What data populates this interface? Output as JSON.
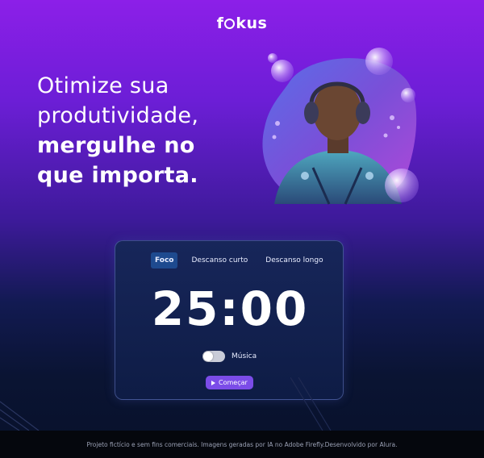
{
  "header": {
    "logo_prefix": "f",
    "logo_suffix": "kus"
  },
  "hero": {
    "headline_light": "Otimize sua produtividade,",
    "headline_bold": "mergulhe no que importa."
  },
  "timer": {
    "tabs": [
      {
        "label": "Foco",
        "active": true
      },
      {
        "label": "Descanso curto",
        "active": false
      },
      {
        "label": "Descanso longo",
        "active": false
      }
    ],
    "time": "25:00",
    "music_label": "Música",
    "music_enabled": false,
    "start_label": "Começar"
  },
  "footer": {
    "text": "Projeto fictício e sem fins comerciais. Imagens geradas por IA no Adobe Firefly.Desenvolvido por Alura."
  },
  "colors": {
    "accent_button": "#7b4ce8",
    "active_tab": "#1e4a8f",
    "card_border": "#7888dc"
  }
}
